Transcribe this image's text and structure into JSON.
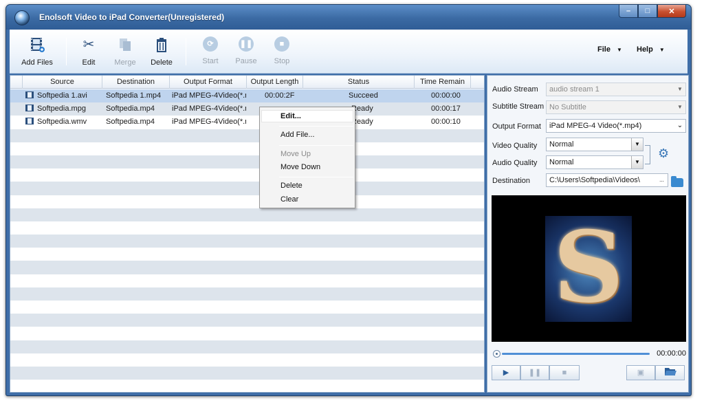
{
  "window": {
    "title": "Enolsoft Video to iPad Converter(Unregistered)"
  },
  "toolbar": {
    "add_files": "Add Files",
    "edit": "Edit",
    "merge": "Merge",
    "delete": "Delete",
    "start": "Start",
    "pause": "Pause",
    "stop": "Stop",
    "file_menu": "File",
    "help_menu": "Help"
  },
  "list": {
    "columns": [
      "Source",
      "Destination",
      "Output Format",
      "Output Length",
      "Status",
      "Time Remain"
    ],
    "rows": [
      {
        "source": "Softpedia 1.avi",
        "destination": "Softpedia 1.mp4",
        "format": "iPad MPEG-4Video(*.mp",
        "length": "00:00:2F",
        "status": "Succeed",
        "remain": "00:00:00"
      },
      {
        "source": "Softpedia.mpg",
        "destination": "Softpedia.mp4",
        "format": "iPad MPEG-4Video(*.mp",
        "length": "",
        "status": "Ready",
        "remain": "00:00:17"
      },
      {
        "source": "Softpedia.wmv",
        "destination": "Softpedia.mp4",
        "format": "iPad MPEG-4Video(*.mp",
        "length": "",
        "status": "Ready",
        "remain": "00:00:10"
      }
    ]
  },
  "context_menu": {
    "edit": "Edit...",
    "add_file": "Add File...",
    "move_up": "Move Up",
    "move_down": "Move Down",
    "delete": "Delete",
    "clear": "Clear"
  },
  "settings": {
    "audio_stream_label": "Audio Stream",
    "audio_stream_value": "audio stream 1",
    "subtitle_stream_label": "Subtitle Stream",
    "subtitle_stream_value": "No Subtitle",
    "output_format_label": "Output Format",
    "output_format_value": "iPad MPEG-4 Video(*.mp4)",
    "video_quality_label": "Video Quality",
    "video_quality_value": "Normal",
    "audio_quality_label": "Audio Quality",
    "audio_quality_value": "Normal",
    "destination_label": "Destination",
    "destination_value": "C:\\Users\\Softpedia\\Videos\\",
    "browse_label": "..."
  },
  "player": {
    "time": "00:00:00",
    "preview_letter": "S",
    "progress": 0
  },
  "colors": {
    "title_bar": "#3b6aa3",
    "accent": "#4f8fd6",
    "selected_row": "#bfd4ee"
  },
  "icons": [
    "app-logo-icon",
    "film-add-icon",
    "scissors-icon",
    "merge-icon",
    "trash-icon",
    "refresh-icon",
    "pause-icon",
    "stop-icon",
    "film-icon",
    "gear-icon",
    "folder-icon",
    "play-icon",
    "snapshot-icon",
    "open-folder-icon"
  ]
}
